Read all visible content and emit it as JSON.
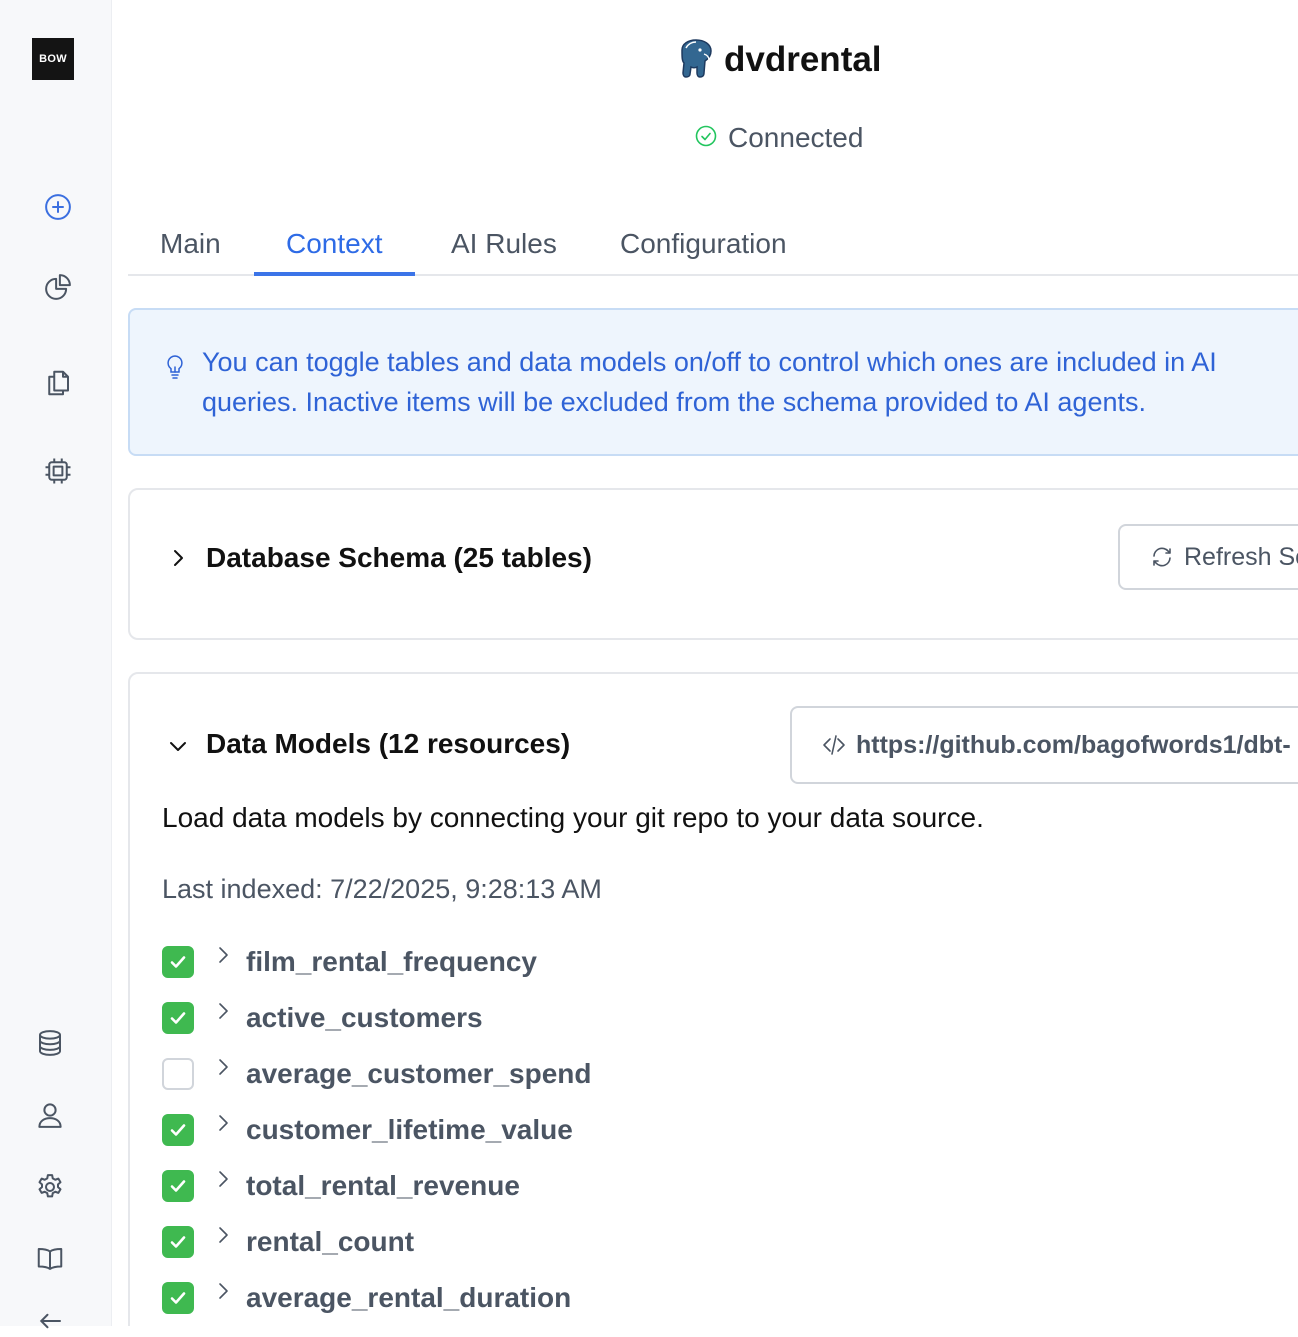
{
  "app": {
    "logo_text": "BOW"
  },
  "sidebar": {
    "top_items": [
      {
        "icon": "plus-circle-icon"
      },
      {
        "icon": "pie-chart-icon"
      },
      {
        "icon": "documents-icon"
      },
      {
        "icon": "cpu-chip-icon"
      }
    ],
    "bottom_items": [
      {
        "icon": "database-icon"
      },
      {
        "icon": "user-icon"
      },
      {
        "icon": "gear-icon"
      },
      {
        "icon": "book-icon"
      },
      {
        "icon": "arrow-left-icon"
      }
    ]
  },
  "header": {
    "title": "dvdrental",
    "status": "Connected",
    "status_color": "#22c55e"
  },
  "tabs": [
    {
      "label": "Main",
      "active": false
    },
    {
      "label": "Context",
      "active": true
    },
    {
      "label": "AI Rules",
      "active": false
    },
    {
      "label": "Configuration",
      "active": false
    }
  ],
  "info": {
    "line1": "You can toggle tables and data models on/off to control which ones are included in AI",
    "line2": "queries. Inactive items will be excluded from the schema provided to AI agents."
  },
  "schema": {
    "title": "Database Schema (25 tables)",
    "refresh_label": "Refresh Schema"
  },
  "data_models": {
    "title": "Data Models (12 resources)",
    "repo_url": "https://github.com/bagofwords1/dbt-",
    "description": "Load data models by connecting your git repo to your data source.",
    "last_indexed": "Last indexed: 7/22/2025, 9:28:13 AM",
    "items": [
      {
        "name": "film_rental_frequency",
        "checked": true
      },
      {
        "name": "active_customers",
        "checked": true
      },
      {
        "name": "average_customer_spend",
        "checked": false
      },
      {
        "name": "customer_lifetime_value",
        "checked": true
      },
      {
        "name": "total_rental_revenue",
        "checked": true
      },
      {
        "name": "rental_count",
        "checked": true
      },
      {
        "name": "average_rental_duration",
        "checked": true
      }
    ]
  },
  "colors": {
    "accent": "#2e6be6",
    "checkbox_on": "#3fb950",
    "info_bg": "#eef5fd"
  }
}
